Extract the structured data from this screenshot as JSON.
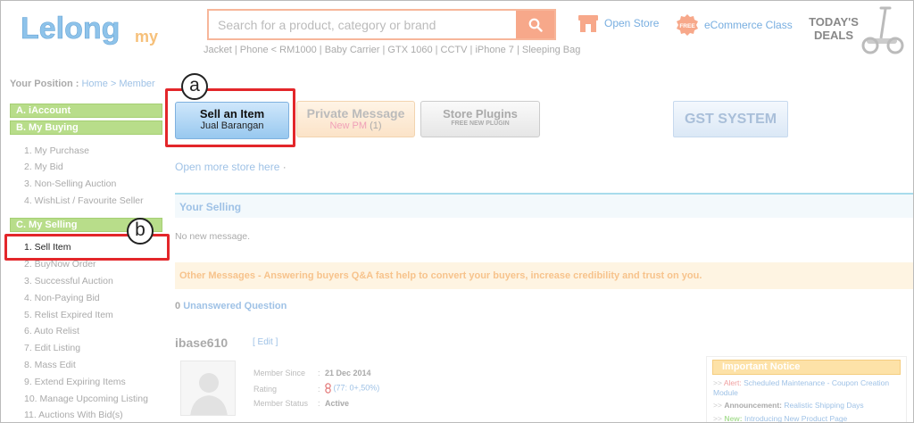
{
  "header": {
    "logo_text": "Lelong",
    "logo_suffix": "my",
    "search": {
      "placeholder": "Search for a product, category or brand"
    },
    "hot_keywords": [
      "Jacket",
      "Phone < RM1000",
      "Baby Carrier",
      "GTX 1060",
      "CCTV",
      "iPhone 7",
      "Sleeping Bag"
    ],
    "open_store_label": "Open Store",
    "ecommerce_label": "eCommerce Class",
    "free_badge": "FREE",
    "todays_deals_line1": "TODAY'S",
    "todays_deals_line2": "DEALS"
  },
  "breadcrumb": {
    "label": "Your Position :",
    "home": "Home",
    "sep": ">",
    "current": "Member"
  },
  "sidebar": {
    "section_a": "A. iAccount",
    "section_b": "B. My Buying",
    "buying_items": [
      "1. My Purchase",
      "2. My Bid",
      "3. Non-Selling Auction",
      "4. WishList / Favourite Seller"
    ],
    "section_c": "C. My Selling",
    "selling_items": [
      "1. Sell Item",
      "2. BuyNow Order",
      "3. Successful Auction",
      "4. Non-Paying Bid",
      "5. Relist Expired Item",
      "6. Auto Relist",
      "7. Edit Listing",
      "8. Mass Edit",
      "9. Extend Expiring Items",
      "10. Manage Upcoming Listing",
      "11. Auctions With Bid(s)"
    ]
  },
  "annotations": {
    "a": "a",
    "b": "b"
  },
  "buttons": {
    "sell_title": "Sell an Item",
    "sell_sub": "Jual Barangan",
    "pm_title": "Private Message",
    "pm_sub": "New PM",
    "pm_count": "(1)",
    "plugins_title": "Store Plugins",
    "plugins_sub": "FREE NEW PLUGIN",
    "gst": "GST SYSTEM"
  },
  "main": {
    "open_more": "Open more store here",
    "open_more_dot": "·",
    "your_selling": "Your Selling",
    "no_message": "No new message.",
    "other_messages": "Other Messages - Answering buyers Q&A fast help to convert your buyers, increase credibility and trust on you.",
    "unanswered_count": "0",
    "unanswered_label": "Unanswered Question",
    "username": "ibase610",
    "edit": "[ Edit ]",
    "member_since_label": "Member Since",
    "member_since_value": "21 Dec 2014",
    "rating_label": "Rating",
    "rating_value": "(77: 0+,50%)",
    "status_label": "Member Status",
    "status_value": "Active",
    "sep": ":"
  },
  "notice": {
    "title": "Important Notice",
    "items": [
      {
        "arrow": ">>",
        "kind": "Alert:",
        "text": "Scheduled Maintenance - Coupon Creation Module"
      },
      {
        "arrow": ">>",
        "kind": "Announcement:",
        "text": "Realistic Shipping Days"
      },
      {
        "arrow": ">>",
        "kind": "New:",
        "text": "Introducing New Product Page"
      }
    ]
  },
  "colors": {
    "accent_blue": "#9fc2e6",
    "search_orange": "#f7a88a",
    "sidebar_green": "#b8dd8a",
    "highlight_red": "#e3262a"
  }
}
